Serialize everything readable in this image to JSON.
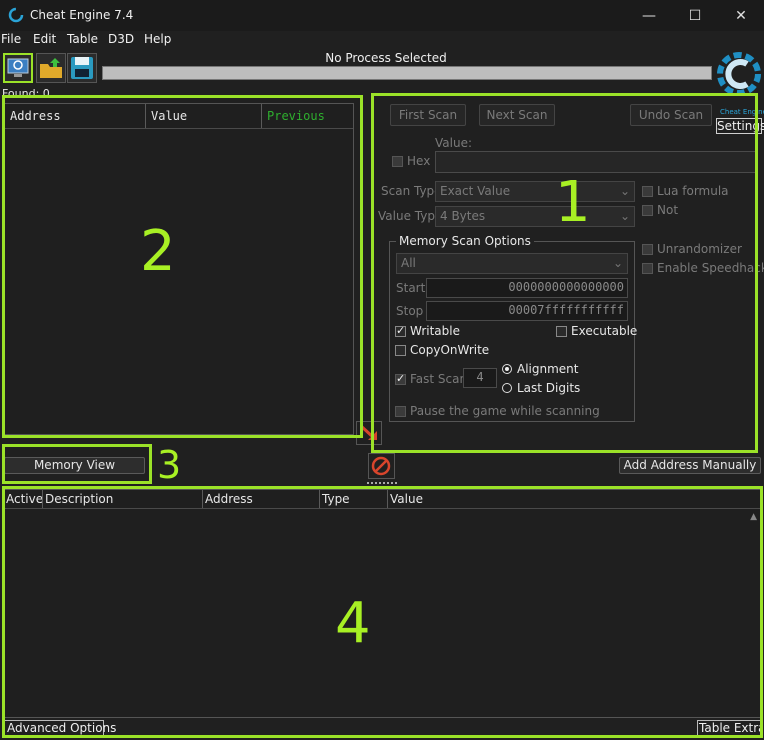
{
  "window": {
    "title": "Cheat Engine 7.4",
    "minimize": "—",
    "maximize": "☐",
    "close": "✕"
  },
  "menu": [
    "File",
    "Edit",
    "Table",
    "D3D",
    "Help"
  ],
  "toolbar": {
    "process_label": "No Process Selected",
    "found_label": "Found: 0"
  },
  "logo": {
    "caption": "Cheat Engine",
    "settings_label": "Settings"
  },
  "results": {
    "headers": [
      "Address",
      "Value",
      "Previous"
    ]
  },
  "scan": {
    "first_scan": "First Scan",
    "next_scan": "Next Scan",
    "undo_scan": "Undo Scan",
    "value_label": "Value:",
    "hex_label": "Hex",
    "scan_type_label": "Scan Type",
    "scan_type_value": "Exact Value",
    "value_type_label": "Value Type",
    "value_type_value": "4 Bytes",
    "lua_formula": "Lua formula",
    "not_label": "Not",
    "mem_options_title": "Memory Scan Options",
    "region_value": "All",
    "start_label": "Start",
    "start_value": "0000000000000000",
    "stop_label": "Stop",
    "stop_value": "00007fffffffffff",
    "writable": "Writable",
    "executable": "Executable",
    "copyonwrite": "CopyOnWrite",
    "fast_scan": "Fast Scan",
    "fast_scan_value": "4",
    "alignment": "Alignment",
    "last_digits": "Last Digits",
    "pause_game": "Pause the game while scanning",
    "unrandomizer": "Unrandomizer",
    "enable_speedhack": "Enable Speedhack"
  },
  "memory_view": "Memory View",
  "add_address": "Add Address Manually",
  "address_list": {
    "headers": [
      "Active",
      "Description",
      "Address",
      "Type",
      "Value"
    ]
  },
  "footer": {
    "advanced": "Advanced Options",
    "table_extras": "Table Extras"
  },
  "annotations": [
    "1",
    "2",
    "3",
    "4"
  ],
  "colors": {
    "highlight": "#9be228",
    "previous_header": "#2eae2e"
  }
}
